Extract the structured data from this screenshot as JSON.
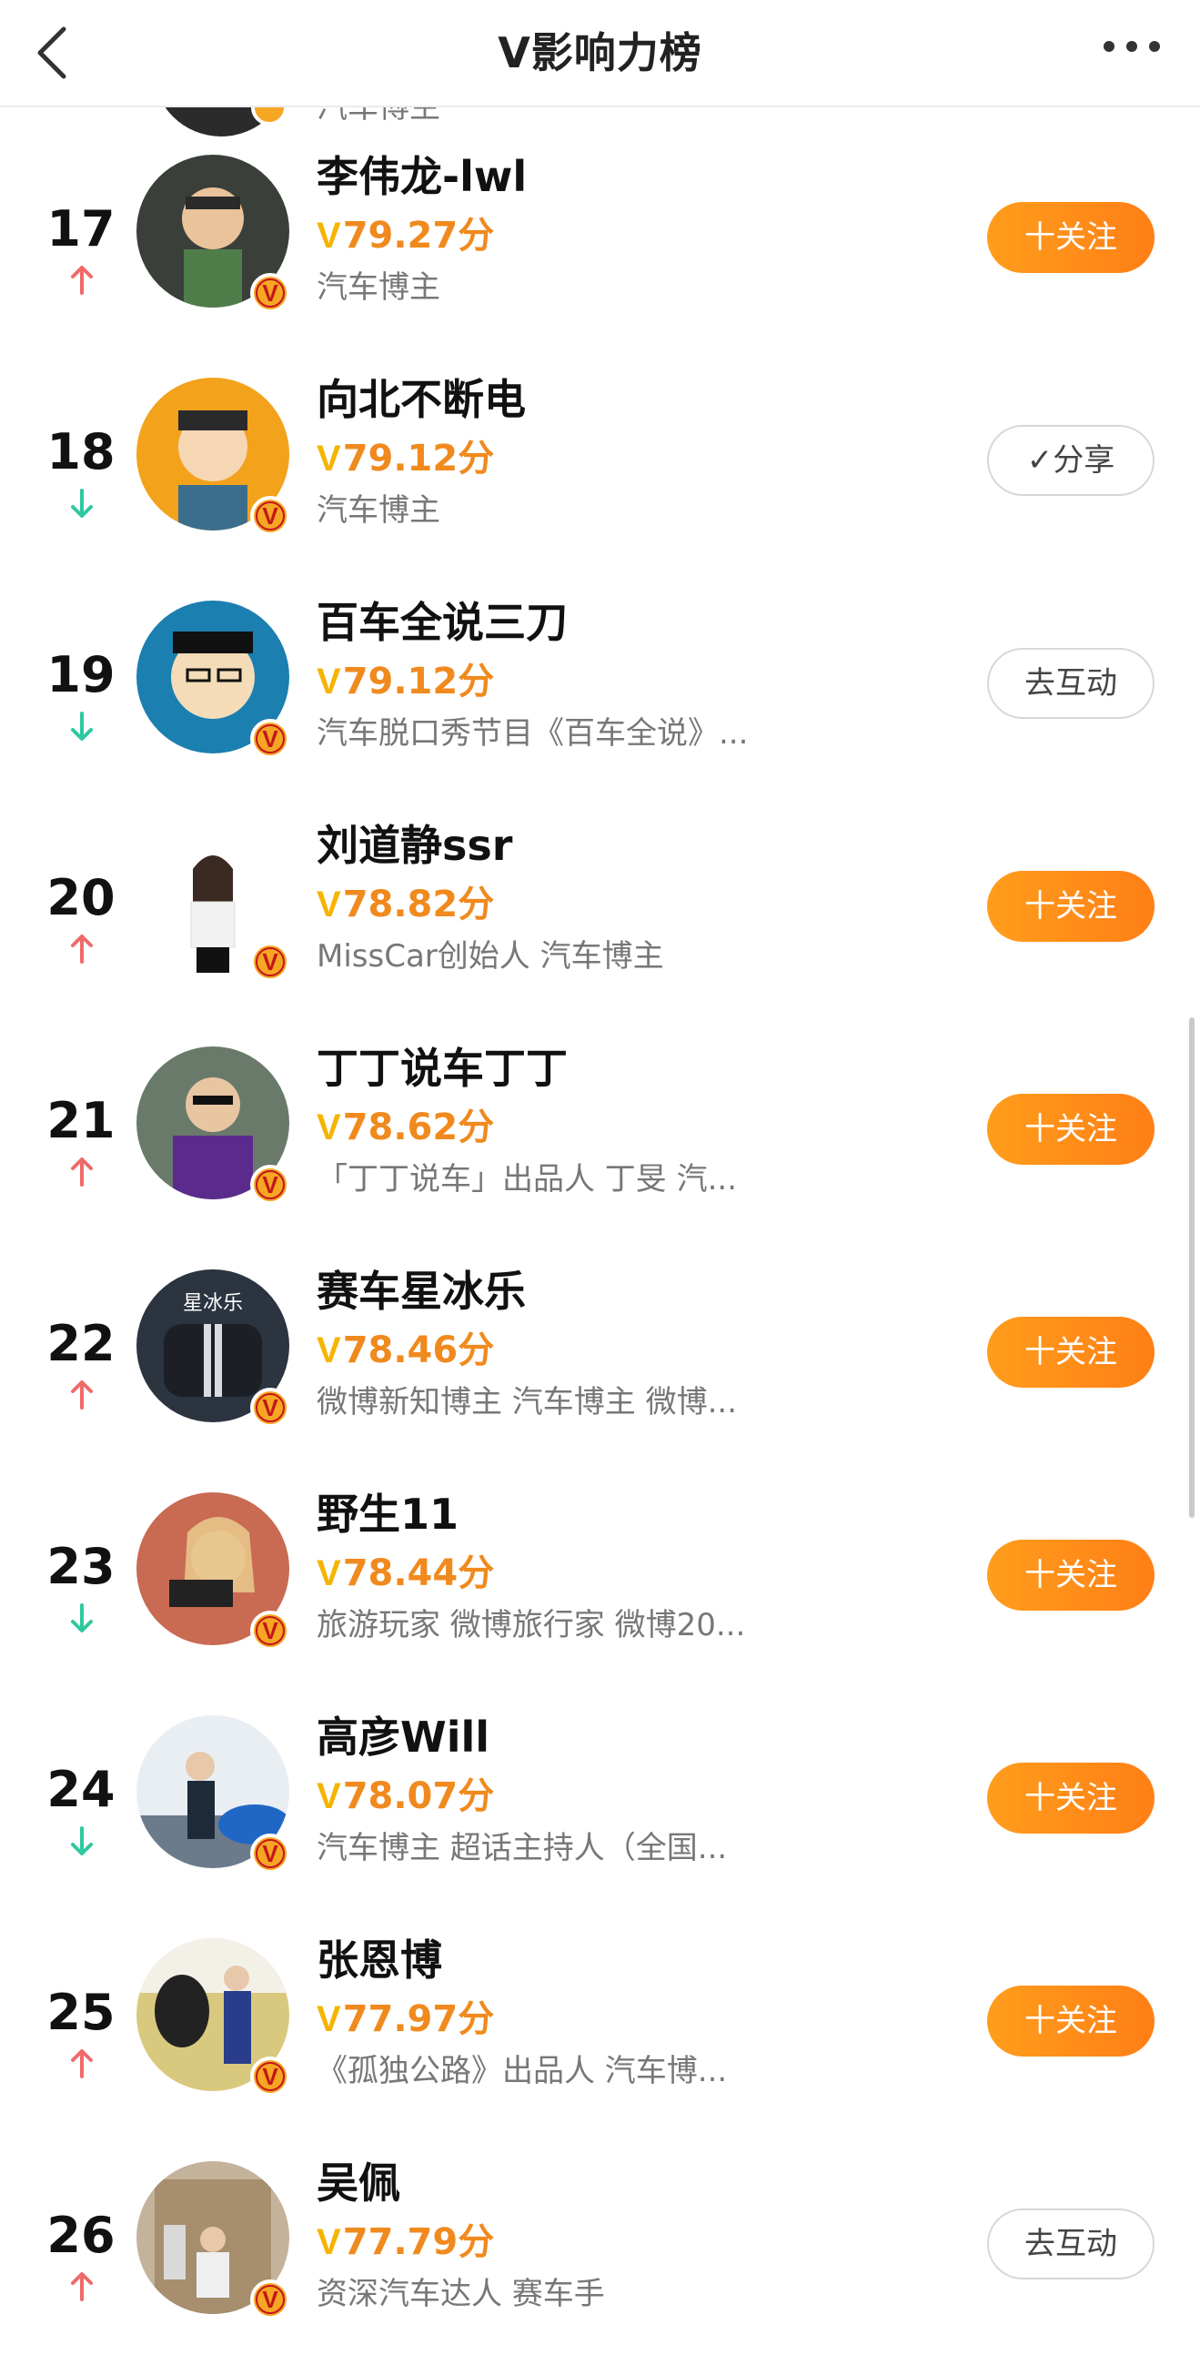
{
  "header": {
    "title": "V影响力榜",
    "back_icon": "chevron-left-icon",
    "more_icon": "more-horizontal-icon"
  },
  "prev_row": {
    "desc": "汽车博主"
  },
  "colors": {
    "accent": "#ff8a1c",
    "score": "#f08a1e",
    "up": "#f06a6a",
    "down": "#2fc8a0"
  },
  "rows": [
    {
      "rank": "17",
      "trend": "up",
      "name": "李伟龙-lwl",
      "score": "79.27分",
      "desc": "汽车博主",
      "button": "十关注"
    },
    {
      "rank": "18",
      "trend": "down",
      "name": "向北不断电",
      "score": "79.12分",
      "desc": "汽车博主",
      "button": "✓分享"
    },
    {
      "rank": "19",
      "trend": "down",
      "name": "百车全说三刀",
      "score": "79.12分",
      "desc": "汽车脱口秀节目《百车全说》...",
      "button": "去互动"
    },
    {
      "rank": "20",
      "trend": "up",
      "name": "刘道静ssr",
      "score": "78.82分",
      "desc": "MissCar创始人 汽车博主",
      "button": "十关注"
    },
    {
      "rank": "21",
      "trend": "up",
      "name": "丁丁说车丁丁",
      "score": "78.62分",
      "desc": "「丁丁说车」出品人 丁旻 汽...",
      "button": "十关注"
    },
    {
      "rank": "22",
      "trend": "up",
      "name": "赛车星冰乐",
      "score": "78.46分",
      "desc": "微博新知博主 汽车博主 微博...",
      "button": "十关注"
    },
    {
      "rank": "23",
      "trend": "down",
      "name": "野生11",
      "score": "78.44分",
      "desc": "旅游玩家 微博旅行家 微博20...",
      "button": "十关注"
    },
    {
      "rank": "24",
      "trend": "down",
      "name": "高彦Will",
      "score": "78.07分",
      "desc": "汽车博主 超话主持人（全国...",
      "button": "十关注"
    },
    {
      "rank": "25",
      "trend": "up",
      "name": "张恩博",
      "score": "77.97分",
      "desc": "《孤独公路》出品人 汽车博...",
      "button": "十关注"
    },
    {
      "rank": "26",
      "trend": "up",
      "name": "吴佩",
      "score": "77.79分",
      "desc": "资深汽车达人 赛车手",
      "button": "去互动"
    }
  ]
}
